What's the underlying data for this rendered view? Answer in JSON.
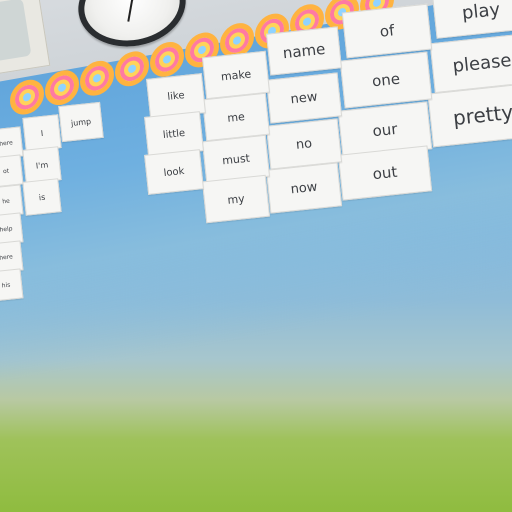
{
  "cards": {
    "play": "play",
    "please": "please",
    "pretty": "pretty",
    "of": "of",
    "one": "one",
    "our": "our",
    "out": "out",
    "name": "name",
    "new": "new",
    "no": "no",
    "now": "now",
    "make": "make",
    "me": "me",
    "must": "must",
    "my": "my",
    "like": "like",
    "little": "little",
    "look": "look",
    "jump": "jump",
    "i": "I",
    "im": "I'm",
    "is": "is"
  },
  "left_cards": [
    "here",
    "ot",
    "he",
    "help",
    "here",
    "his"
  ],
  "colors": {
    "wall": "#cfd4d8",
    "board_blue": "#6fb0e0",
    "grass_green": "#8fbc3f",
    "card": "#f6f6f4",
    "clock_rim": "#2a2d30",
    "border_orange": "#ffb340",
    "border_pink": "#ff7aa2"
  }
}
